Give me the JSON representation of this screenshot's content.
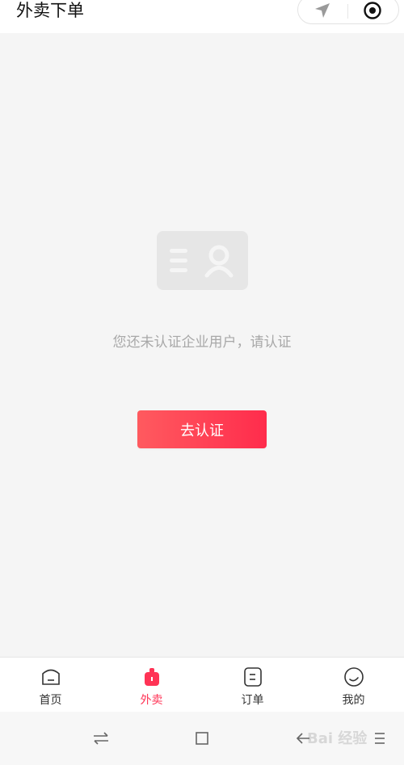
{
  "header": {
    "title": "外卖下单"
  },
  "empty_state": {
    "message": "您还未认证企业用户，请认证",
    "action_label": "去认证"
  },
  "tabbar": {
    "items": [
      {
        "label": "首页",
        "icon": "home-icon",
        "active": false
      },
      {
        "label": "外卖",
        "icon": "takeout-bag-icon",
        "active": true
      },
      {
        "label": "订单",
        "icon": "order-icon",
        "active": false
      },
      {
        "label": "我的",
        "icon": "profile-icon",
        "active": false
      }
    ]
  },
  "colors": {
    "accent": "#ff3355",
    "background": "#f5f5f5"
  },
  "watermark": "Bai 经验"
}
